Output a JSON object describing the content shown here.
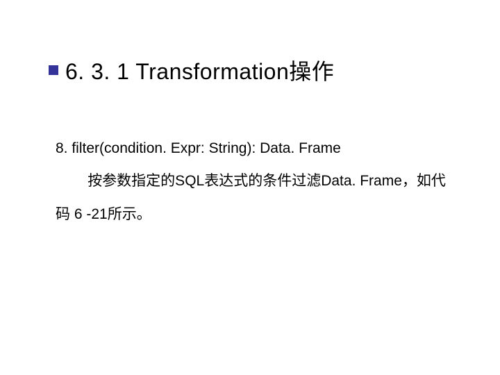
{
  "heading": "6. 3. 1 Transformation操作",
  "item_label": "8. filter(condition. Expr: String): Data. Frame",
  "description": "按参数指定的SQL表达式的条件过滤Data. Frame，如代码 6 -21所示。"
}
